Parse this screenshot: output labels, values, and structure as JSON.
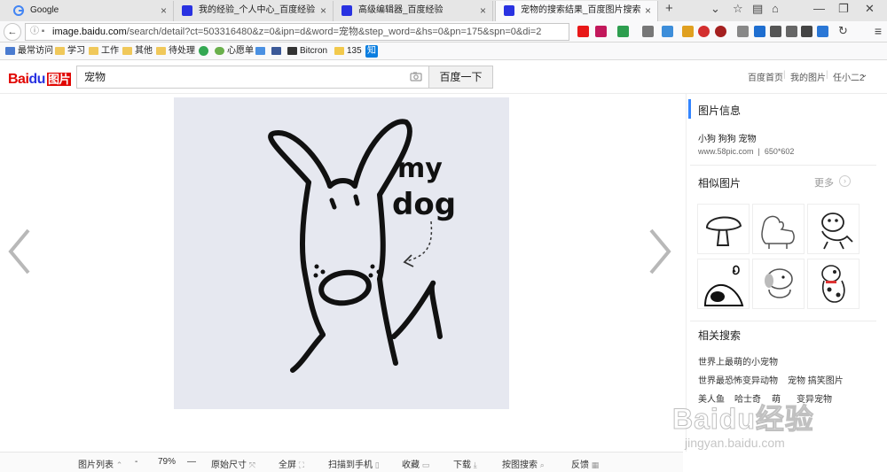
{
  "browser": {
    "tabs": [
      {
        "title": "Google",
        "active": false
      },
      {
        "title": "我的经验_个人中心_百度经验",
        "active": false
      },
      {
        "title": "高级编辑器_百度经验",
        "active": false
      },
      {
        "title": "宠物的搜索结果_百度图片搜索",
        "active": true
      }
    ],
    "url_host": "image.baidu.com",
    "url_path": "/search/detail?ct=503316480&z=0&ipn=d&word=宠物&step_word=&hs=0&pn=175&spn=0&di=2",
    "bookmarks": [
      "最常访问",
      "学习",
      "工作",
      "其他",
      "待处理",
      "心愿单",
      "Bitcron",
      "135",
      "知"
    ]
  },
  "header": {
    "logo_bai": "Bai",
    "logo_du": "du",
    "logo_tu": "图片",
    "search_value": "宠物",
    "search_button": "百度一下",
    "links": [
      "百度首页",
      "我的图片",
      "任小二2"
    ]
  },
  "image": {
    "caption_my": "my",
    "caption_dog": "dog"
  },
  "sidebar": {
    "info_title": "图片信息",
    "tags": "小狗 狗狗 宠物",
    "source": "www.58pic.com",
    "size": "650*602",
    "similar_title": "相似图片",
    "more": "更多",
    "related_title": "相关搜索",
    "related": [
      [
        "世界上最萌的小宠物"
      ],
      [
        "世界最恐怖变异动物",
        "宠物 搞笑图片"
      ],
      [
        "美人鱼",
        "哈士奇",
        "萌",
        "变异宠物"
      ]
    ]
  },
  "toolbar": {
    "list": "图片列表",
    "zoom_out": "-",
    "zoom": "79%",
    "zoom_in": "—",
    "original": "原始尺寸",
    "fullscreen": "全屏",
    "scan": "扫描到手机",
    "collect": "收藏",
    "download": "下载",
    "search_by_image": "按图搜索",
    "feedback": "反馈"
  },
  "watermark": {
    "big": "Baidu经验",
    "small": "jingyan.baidu.com"
  },
  "colors": {
    "baidu_red": "#e10602",
    "baidu_blue": "#2932e1",
    "accent_blue": "#3385ff",
    "photo_bg": "#e6e8f0"
  }
}
